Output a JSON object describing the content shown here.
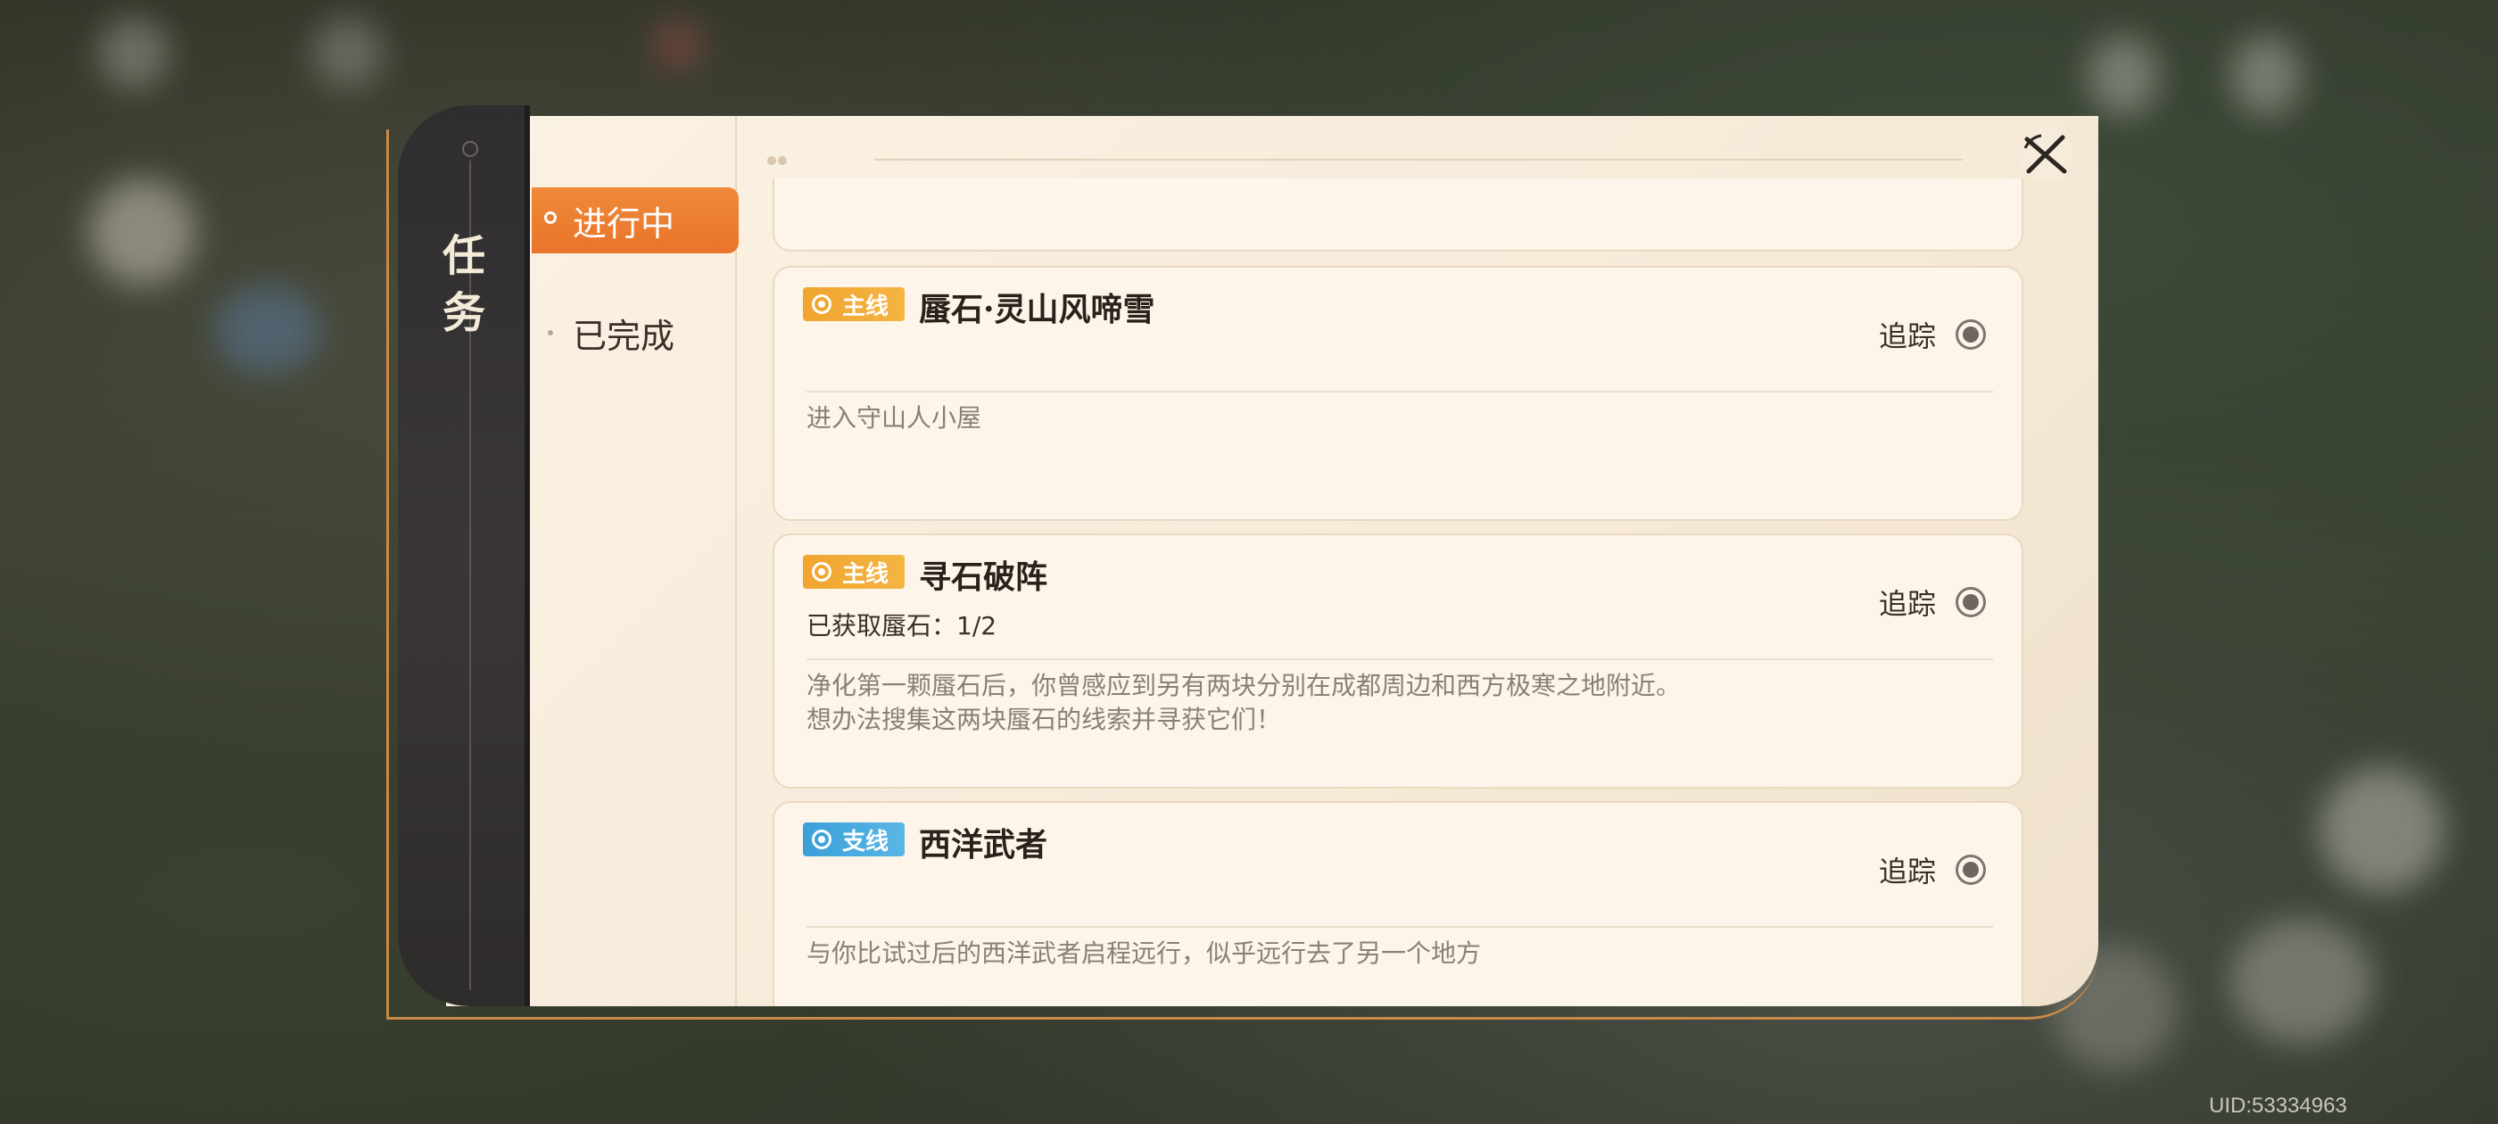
{
  "sidebar": {
    "title": "任务",
    "tabs": [
      {
        "label": "进行中",
        "active": true
      },
      {
        "label": "已完成",
        "active": false
      }
    ]
  },
  "quests": [
    {
      "tag": "主线",
      "tag_color": "#f0a52f",
      "title": "蜃石·灵山风啼雪",
      "progress": "",
      "description": "进入守山人小屋",
      "track_label": "追踪"
    },
    {
      "tag": "主线",
      "tag_color": "#f0a52f",
      "title": "寻石破阵",
      "progress": "已获取蜃石：1/2",
      "description": "净化第一颗蜃石后，你曾感应到另有两块分别在成都周边和西方极寒之地附近。想办法搜集这两块蜃石的线索并寻获它们！",
      "track_label": "追踪"
    },
    {
      "tag": "支线",
      "tag_color": "#3aa0d8",
      "title": "西洋武者",
      "progress": "",
      "description": "与你比试过后的西洋武者启程远行，似乎远行去了另一个地方",
      "track_label": "追踪"
    }
  ],
  "footer": {
    "uid": "UID:53334963"
  },
  "colors": {
    "accent_orange": "#e8742a",
    "panel_bg": "#fbf2e4",
    "spine_dark": "#2f2d30"
  }
}
